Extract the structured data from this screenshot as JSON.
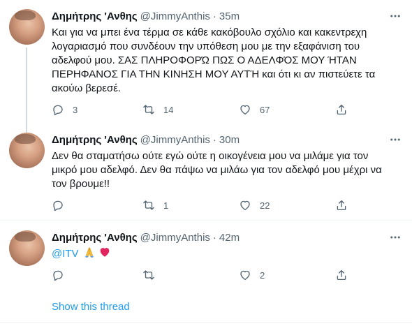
{
  "tweets": [
    {
      "name": "Δημήτρης 'Ανθης",
      "handle": "@JimmyAnthis",
      "separator": "·",
      "time": "35m",
      "lines": [
        "Και για να μπει ένα τέρμα σε κάθε κακόβουλο σχόλιο και κακεντρεχη",
        "λογαριασμό που συνδέουν την υπόθεση μου με την εξαφάνιση του",
        "αδελφού μου. ΣΑΣ ΠΛΗΡΟΦΟΡΏ ΠΩΣ Ο ΑΔΕΛΦΌΣ ΜΟΥ ΉΤΑΝ",
        "ΠΕΡΗΦΑΝΟΣ ΓΙΑ ΤΗΝ ΚΙΝΗΣΗ ΜΟΥ ΑΥΤΉ και ότι κι αν πιστεύετε τα",
        "ακούω βερεσέ."
      ],
      "replies": "3",
      "retweets": "14",
      "likes": "67"
    },
    {
      "name": "Δημήτρης 'Ανθης",
      "handle": "@JimmyAnthis",
      "separator": "·",
      "time": "30m",
      "lines": [
        "Δεν θα σταματήσω ούτε εγώ ούτε η οικογένεια μου να μιλάμε για τον",
        "μικρό μου αδελφό. Δεν θα πάψω να μιλάω για τον αδελφό μου μέχρι να",
        "τον βρουμε!!"
      ],
      "replies": "",
      "retweets": "1",
      "likes": "22"
    },
    {
      "name": "Δημήτρης 'Ανθης",
      "handle": "@JimmyAnthis",
      "separator": "·",
      "time": "42m",
      "mention": "@ITV",
      "emojis": [
        "folded-hands",
        "red-heart"
      ],
      "replies": "",
      "retweets": "",
      "likes": "2"
    }
  ],
  "show_thread": "Show this thread",
  "colors": {
    "accent": "#1d9bf0",
    "secondary_text": "#536471",
    "primary_text": "#0f1419",
    "thread_line": "#cfd9de",
    "divider": "#eff3f4",
    "heart": "#e0245e"
  },
  "icons": {
    "more": "more-dots-icon",
    "reply": "reply-bubble-icon",
    "retweet": "retweet-arrows-icon",
    "like": "heart-outline-icon",
    "share": "share-upload-icon"
  }
}
